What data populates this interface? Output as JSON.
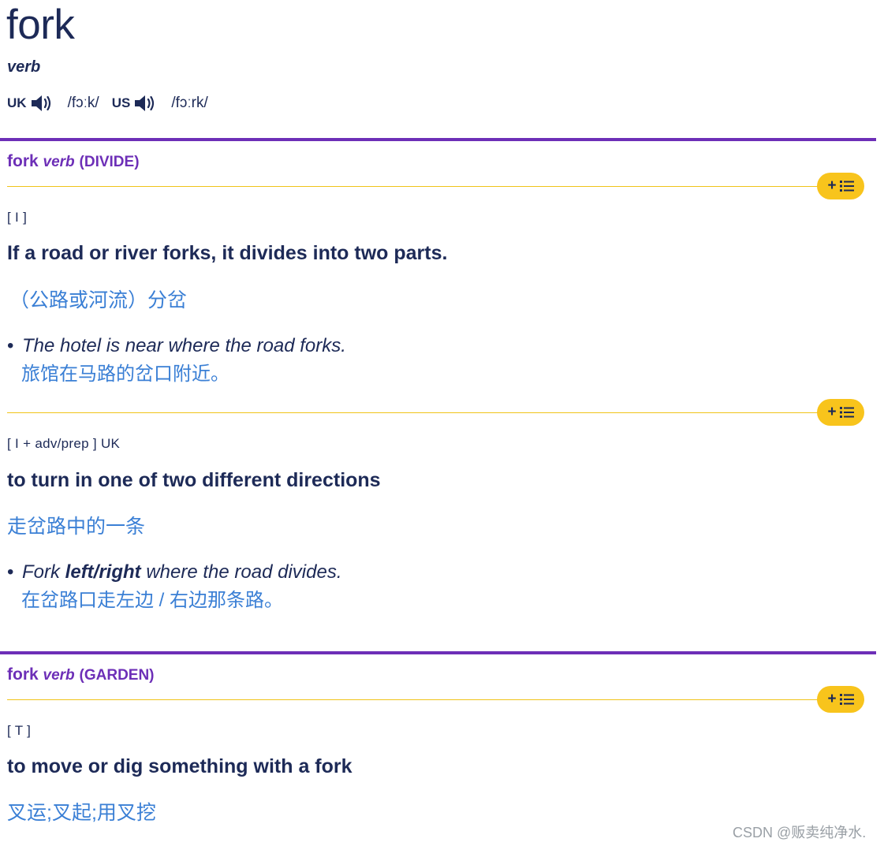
{
  "entry": {
    "headword": "fork",
    "pos": "verb",
    "pron": [
      {
        "region": "UK",
        "ipa": "/fɔːk/"
      },
      {
        "region": "US",
        "ipa": "/fɔːrk/"
      }
    ]
  },
  "senses": [
    {
      "word": "fork",
      "pos": "verb",
      "guide": "(DIVIDE)",
      "defs": [
        {
          "gram": "[ I ]",
          "def": "If a road or river forks, it divides into two parts.",
          "trans": "（公路或河流）分岔",
          "example": {
            "pre": "The hotel is near where the road forks.",
            "bold": "",
            "post": "",
            "trans": "旅馆在马路的岔口附近。"
          }
        },
        {
          "gram": "[ I + adv/prep ] UK",
          "def": "to turn in one of two different directions",
          "trans": "走岔路中的一条",
          "example": {
            "pre": "Fork ",
            "bold": "left/right",
            "post": " where the road divides.",
            "trans": "在岔路口走左边 / 右边那条路。"
          }
        }
      ]
    },
    {
      "word": "fork",
      "pos": "verb",
      "guide": "(GARDEN)",
      "defs": [
        {
          "gram": "[ T ]",
          "def": "to move or dig something with a fork",
          "trans": "叉运;叉起;用叉挖"
        }
      ]
    }
  ],
  "add_to_list": {
    "plus": "+"
  },
  "icons": {
    "speaker": "speaker-icon",
    "list": "list-icon"
  },
  "colors": {
    "text": "#1d2a57",
    "accent_purple": "#6d2fb7",
    "translation_blue": "#3a7fd5",
    "pill_gold": "#f8c41c"
  },
  "watermark": "CSDN @贩卖纯净水."
}
